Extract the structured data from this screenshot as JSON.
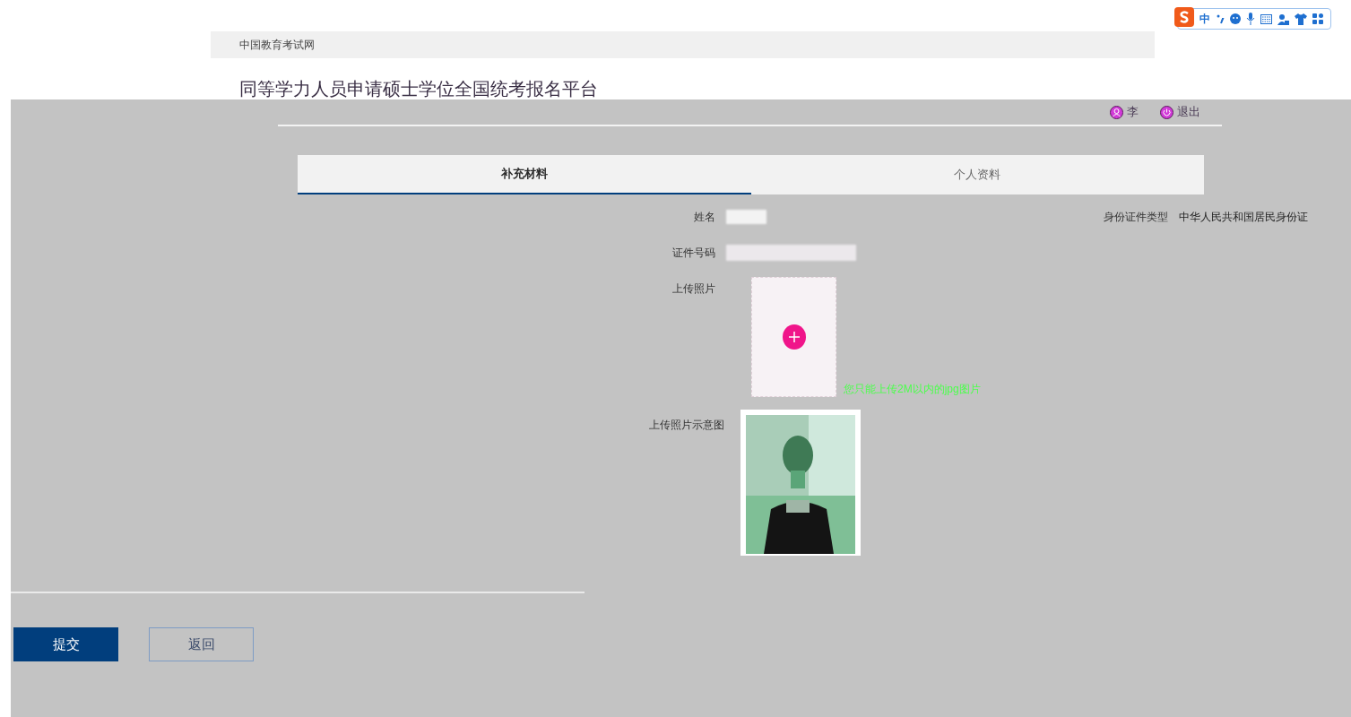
{
  "ime_toolbar": {
    "mode": "中"
  },
  "header": {
    "site": "中国教育考试网"
  },
  "title": "同等学力人员申请硕士学位全国统考报名平台",
  "user": {
    "name": "李",
    "logout": "退出"
  },
  "tabs": [
    {
      "label": "补充材料",
      "selected": true
    },
    {
      "label": "个人资料",
      "selected": false
    }
  ],
  "form": {
    "name_label": "姓名",
    "id_number_label": "证件号码",
    "id_type_label": "身份证件类型",
    "id_type_value": "中华人民共和国居民身份证",
    "photo_label": "上传照片",
    "photo_hint": "您只能上传2M以内的jpg图片",
    "sample_label": "上传照片示意图"
  },
  "buttons": [
    {
      "label": "提交",
      "kind": "primary"
    },
    {
      "label": "返回",
      "kind": "secondary"
    }
  ]
}
